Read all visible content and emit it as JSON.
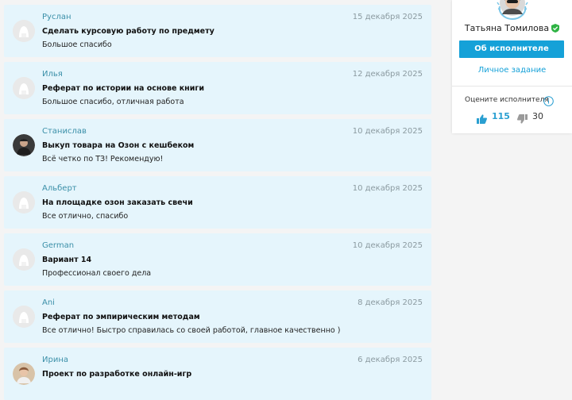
{
  "reviews": [
    {
      "name": "Руслан",
      "date": "15 декабря 2025",
      "title": "Сделать курсовую работу по предмету",
      "text": "Большое спасибо",
      "avatar": "default-avatar"
    },
    {
      "name": "Илья",
      "date": "12 декабря 2025",
      "title": "Реферат по истории на основе книги",
      "text": "Большое спасибо, отличная работа",
      "avatar": "default-avatar"
    },
    {
      "name": "Станислав",
      "date": "10 декабря 2025",
      "title": "Выкуп товара на Озон с кешбеком",
      "text": "Всё четко по ТЗ! Рекомендую!",
      "avatar": "photo-avatar"
    },
    {
      "name": "Альберт",
      "date": "10 декабря 2025",
      "title": "На площадке озон заказать свечи",
      "text": "Все отлично, спасибо",
      "avatar": "default-avatar"
    },
    {
      "name": "German",
      "date": "10 декабря 2025",
      "title": "Вариант 14",
      "text": "Профессионал своего дела",
      "avatar": "default-avatar"
    },
    {
      "name": "Ani",
      "date": "8 декабря 2025",
      "title": "Реферат по эмпирическим методам",
      "text": "Все отлично! Быстро справилась со своей работой, главное качественно )",
      "avatar": "default-avatar"
    },
    {
      "name": "Ирина",
      "date": "6 декабря 2025",
      "title": "Проект по разработке онлайн-игр",
      "text": "",
      "avatar": "photo-avatar"
    }
  ],
  "profile": {
    "name": "Татьяна Томилова",
    "about_button": "Об исполнителе",
    "task_link": "Личное задание",
    "rate_label": "Оцените исполнителя",
    "likes": "115",
    "dislikes": "30",
    "accent_color": "#15a1d8",
    "verified_color": "#2fb344"
  }
}
